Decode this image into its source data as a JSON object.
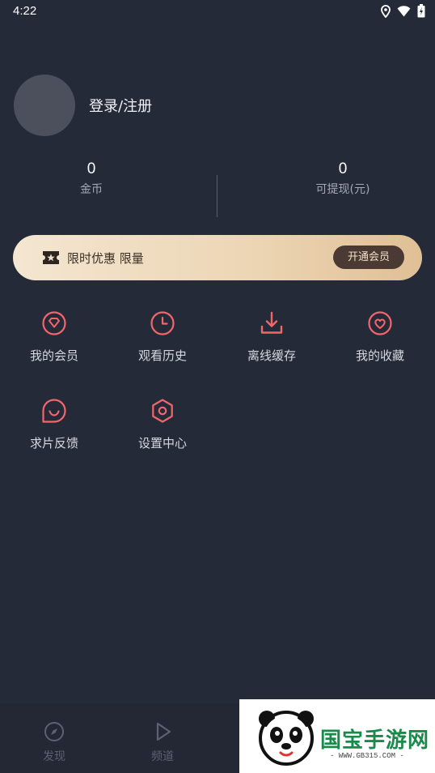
{
  "status_bar": {
    "time": "4:22"
  },
  "profile": {
    "login_label": "登录/注册"
  },
  "stats": [
    {
      "value": "0",
      "label": "金币"
    },
    {
      "value": "0",
      "label": "可提现(元)"
    }
  ],
  "vip_banner": {
    "text": "限时优惠 限量",
    "button_label": "开通会员"
  },
  "menu": [
    {
      "label": "我的会员",
      "icon": "diamond-icon"
    },
    {
      "label": "观看历史",
      "icon": "clock-icon"
    },
    {
      "label": "离线缓存",
      "icon": "download-icon"
    },
    {
      "label": "我的收藏",
      "icon": "heart-icon"
    },
    {
      "label": "求片反馈",
      "icon": "chat-smile-icon"
    },
    {
      "label": "设置中心",
      "icon": "hexagon-settings-icon"
    }
  ],
  "bottom_nav": [
    {
      "label": "发现",
      "icon": "compass-icon"
    },
    {
      "label": "频道",
      "icon": "play-icon"
    }
  ],
  "watermark": {
    "name": "国宝手游网",
    "url": "- WWW.GB315.COM -"
  },
  "colors": {
    "background": "#252a38",
    "accent": "#f2666b",
    "vip_gold": "#ecd5b3"
  }
}
